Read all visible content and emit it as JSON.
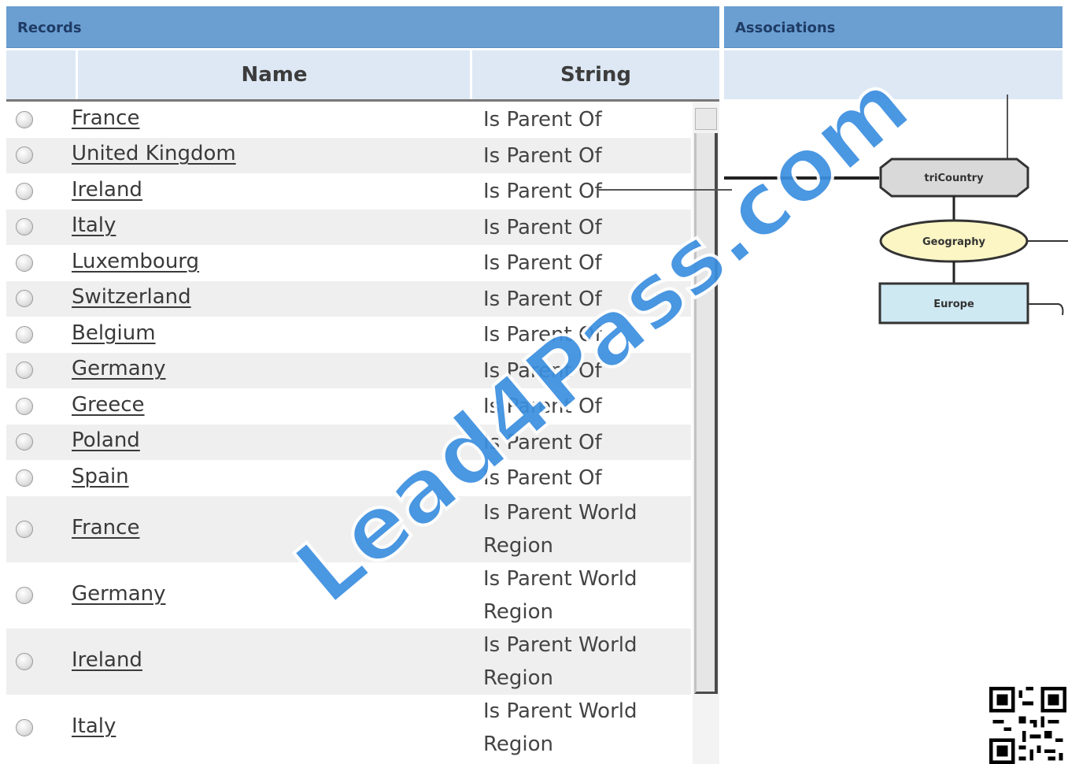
{
  "records": {
    "title": "Records",
    "columns": {
      "name": "Name",
      "string": "String"
    },
    "rows": [
      {
        "name": "France",
        "string": "Is Parent Of"
      },
      {
        "name": "United Kingdom",
        "string": "Is Parent Of"
      },
      {
        "name": "Ireland",
        "string": "Is Parent Of"
      },
      {
        "name": "Italy",
        "string": "Is Parent Of"
      },
      {
        "name": "Luxembourg",
        "string": "Is Parent Of"
      },
      {
        "name": "Switzerland",
        "string": "Is Parent Of"
      },
      {
        "name": "Belgium",
        "string": "Is Parent Of"
      },
      {
        "name": "Germany",
        "string": "Is Parent Of"
      },
      {
        "name": "Greece",
        "string": "Is Parent Of"
      },
      {
        "name": "Poland",
        "string": "Is Parent Of"
      },
      {
        "name": "Spain",
        "string": "Is Parent Of"
      },
      {
        "name": "France",
        "string": "Is Parent World Region"
      },
      {
        "name": "Germany",
        "string": "Is Parent World Region"
      },
      {
        "name": "Ireland",
        "string": "Is Parent World Region"
      },
      {
        "name": "Italy",
        "string": "Is Parent World Region"
      }
    ]
  },
  "associations": {
    "title": "Associations",
    "nodes": {
      "tricountry": "triCountry",
      "geography": "Geography",
      "europe": "Europe"
    }
  },
  "watermark": {
    "text": "Lead4Pass.com"
  },
  "colors": {
    "titlebar": "#6b9fd2",
    "header": "#dde8f4",
    "geography_fill": "#fbf6c4",
    "europe_fill": "#cfe9f3",
    "tricountry_fill": "#d9d9d9",
    "watermark": "#3b8fe0"
  }
}
